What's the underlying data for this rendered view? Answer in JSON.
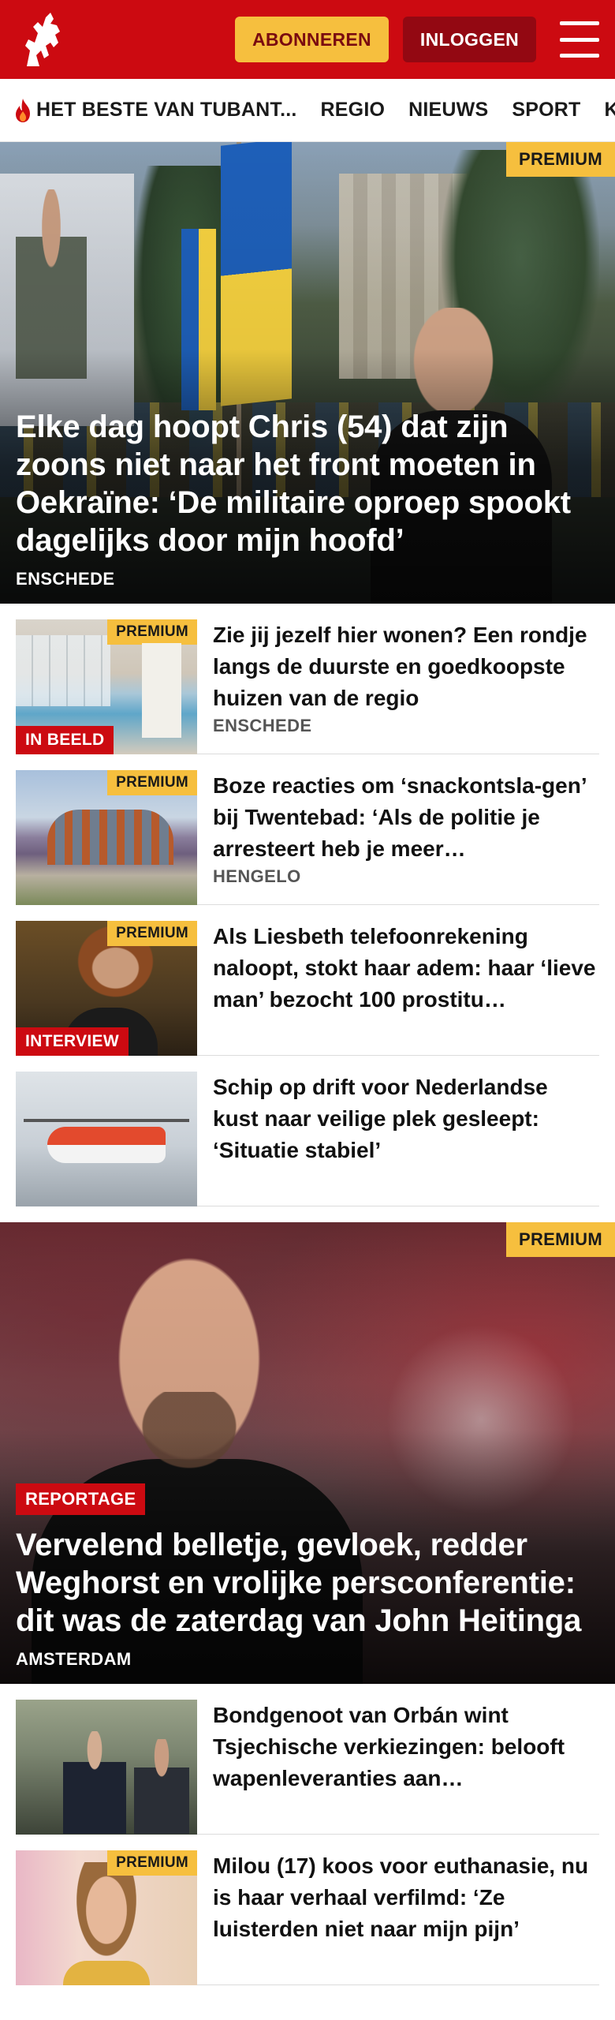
{
  "header": {
    "logo_icon": "tubantia-horse-logo-icon",
    "subscribe_label": "ABONNEREN",
    "login_label": "INLOGGEN",
    "menu_icon": "hamburger-menu-icon",
    "colors": {
      "brand": "#cc0a11",
      "subscribe_bg": "#f6bf3e",
      "login_bg": "#930812"
    }
  },
  "nav": {
    "items": [
      {
        "label": "HET BESTE VAN TUBANT...",
        "icon": "flame-icon"
      },
      {
        "label": "REGIO"
      },
      {
        "label": "NIEUWS"
      },
      {
        "label": "SPORT"
      },
      {
        "label": "K"
      }
    ]
  },
  "hero": {
    "badge": "PREMIUM",
    "title": "Elke dag hoopt Chris (54) dat zijn zoons niet naar het front moeten in Oekraïne: ‘De militaire oproep spookt dagelijks door mijn hoofd’",
    "location": "ENSCHEDE"
  },
  "articles": [
    {
      "badge": "PREMIUM",
      "tag": "IN BEELD",
      "title": "Zie jij jezelf hier wonen? Een rondje langs de duurste en goedkoopste huizen van de regio",
      "location": "ENSCHEDE"
    },
    {
      "badge": "PREMIUM",
      "title": "Boze reacties om ‘snackontsla-gen’ bij Twentebad: ‘Als de politie je arresteert heb je meer…",
      "location": "HENGELO"
    },
    {
      "badge": "PREMIUM",
      "tag": "INTERVIEW",
      "title": "Als Liesbeth telefoonrekening naloopt, stokt haar adem: haar ‘lieve man’ bezocht 100 prostitu…"
    },
    {
      "title": "Schip op drift voor Nederlandse kust naar veilige plek gesleept: ‘Situatie stabiel’"
    }
  ],
  "feature": {
    "badge": "PREMIUM",
    "tag": "REPORTAGE",
    "title": "Vervelend belletje, gevloek, redder Weghorst en vrolijke persconferentie: dit was de zaterdag van John Heitinga",
    "location": "AMSTERDAM"
  },
  "articles2": [
    {
      "title": "Bondgenoot van Orbán wint Tsjechische verkiezingen: belooft wapenleveranties aan…"
    },
    {
      "badge": "PREMIUM",
      "title": "Milou (17) koos voor euthanasie, nu is haar verhaal verfilmd: ‘Ze luisterden niet naar mijn pijn’"
    }
  ]
}
